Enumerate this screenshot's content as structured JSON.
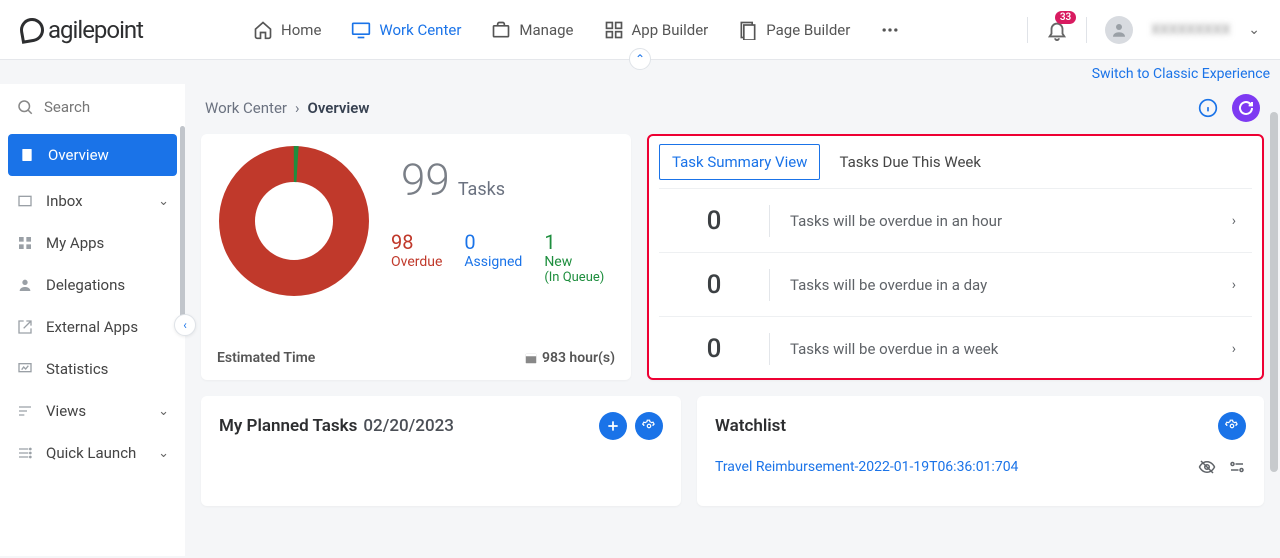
{
  "header": {
    "logo_text": "agilepoint",
    "nav": [
      {
        "label": "Home",
        "icon": "home-icon"
      },
      {
        "label": "Work Center",
        "icon": "monitor-icon",
        "active": true
      },
      {
        "label": "Manage",
        "icon": "briefcase-icon"
      },
      {
        "label": "App Builder",
        "icon": "grid-icon"
      },
      {
        "label": "Page Builder",
        "icon": "page-icon"
      }
    ],
    "notification_count": "33",
    "username": "XXXXXXXXX"
  },
  "subbanner": {
    "classic_link": "Switch to Classic Experience"
  },
  "sidebar": {
    "search_placeholder": "Search",
    "items": [
      {
        "label": "Overview",
        "icon": "clipboard-icon",
        "active": true
      },
      {
        "label": "Inbox",
        "icon": "inbox-icon",
        "expandable": true
      },
      {
        "label": "My Apps",
        "icon": "apps-icon"
      },
      {
        "label": "Delegations",
        "icon": "person-icon"
      },
      {
        "label": "External Apps",
        "icon": "external-icon"
      },
      {
        "label": "Statistics",
        "icon": "stats-icon"
      },
      {
        "label": "Views",
        "icon": "views-icon",
        "expandable": true
      },
      {
        "label": "Quick Launch",
        "icon": "quick-icon",
        "expandable": true
      }
    ]
  },
  "breadcrumb": {
    "parent": "Work Center",
    "sep": "›",
    "current": "Overview"
  },
  "tasks_card": {
    "total": "99",
    "total_label": "Tasks",
    "stats": {
      "overdue": {
        "n": "98",
        "label": "Overdue"
      },
      "assigned": {
        "n": "0",
        "label": "Assigned"
      },
      "new": {
        "n": "1",
        "label": "New",
        "sub": "(In Queue)"
      }
    },
    "estimated_label": "Estimated Time",
    "estimated_value": "983 hour(s)"
  },
  "chart_data": {
    "type": "pie",
    "title": "Tasks",
    "series": [
      {
        "name": "Overdue",
        "value": 98,
        "color": "#c0392b"
      },
      {
        "name": "New (In Queue)",
        "value": 1,
        "color": "#1e8e3e"
      },
      {
        "name": "Assigned",
        "value": 0,
        "color": "#1a73e8"
      }
    ],
    "total": 99,
    "inner_radius_ratio": 0.55
  },
  "summary_card": {
    "tabs": [
      {
        "label": "Task Summary View",
        "active": true
      },
      {
        "label": "Tasks Due This Week"
      }
    ],
    "rows": [
      {
        "count": "0",
        "text": "Tasks will be overdue in an hour"
      },
      {
        "count": "0",
        "text": "Tasks will be overdue in a day"
      },
      {
        "count": "0",
        "text": "Tasks will be overdue in a week"
      }
    ]
  },
  "planned_card": {
    "title": "My Planned Tasks",
    "date": "02/20/2023"
  },
  "watch_card": {
    "title": "Watchlist",
    "items": [
      {
        "label": "Travel Reimbursement-2022-01-19T06:36:01:704"
      }
    ]
  }
}
